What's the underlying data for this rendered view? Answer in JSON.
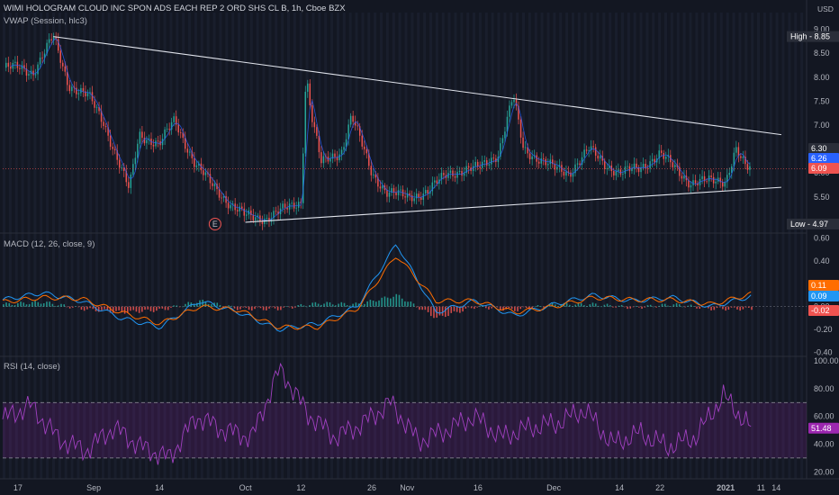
{
  "header": {
    "title": "WIMI HOLOGRAM CLOUD INC SPON ADS EACH REP 2 ORD SHS CL B, 1h, Cboe BZX",
    "currency": "USD"
  },
  "panes": {
    "price": {
      "label": "VWAP (Session, hlc3)"
    },
    "macd": {
      "label": "MACD (12, 26, close, 9)"
    },
    "rsi": {
      "label": "RSI (14, close)"
    }
  },
  "colors": {
    "background": "#131722",
    "up": "#26a69a",
    "down": "#ef5350",
    "vwap": "#2962ff",
    "macd": "#2196f3",
    "signal": "#ff6d00",
    "rsi": "#9c27b0",
    "trendline": "#e0e3eb"
  },
  "chart_data": [
    {
      "type": "candlestick",
      "pane": "price",
      "title": "WIMI HOLOGRAM CLOUD INC SPON ADS EACH REP 2 ORD SHS CL B, 1h, Cboe BZX",
      "x_ticks": [
        "17",
        "Sep",
        "14",
        "Oct",
        "12",
        "26",
        "Nov",
        "16",
        "Dec",
        "14",
        "22",
        "2021",
        "11",
        "14"
      ],
      "x_tick_dates": [
        "2020-08-17",
        "2020-09-01",
        "2020-09-14",
        "2020-10-01",
        "2020-10-12",
        "2020-10-26",
        "2020-11-02",
        "2020-11-16",
        "2020-12-01",
        "2020-12-14",
        "2020-12-22",
        "2021-01-04",
        "2021-01-11",
        "2021-01-14"
      ],
      "y_ticks": [
        9.0,
        8.5,
        8.0,
        7.5,
        7.0,
        6.5,
        6.0,
        5.5
      ],
      "ylim": [
        4.8,
        9.2
      ],
      "close_path": [
        {
          "date": "2020-08-17",
          "close": 8.2
        },
        {
          "date": "2020-08-20",
          "close": 8.1
        },
        {
          "date": "2020-08-24",
          "close": 8.85
        },
        {
          "date": "2020-08-27",
          "close": 7.85
        },
        {
          "date": "2020-08-31",
          "close": 7.6
        },
        {
          "date": "2020-09-03",
          "close": 7.05
        },
        {
          "date": "2020-09-08",
          "close": 5.65
        },
        {
          "date": "2020-09-10",
          "close": 6.8
        },
        {
          "date": "2020-09-14",
          "close": 6.6
        },
        {
          "date": "2020-09-17",
          "close": 7.1
        },
        {
          "date": "2020-09-21",
          "close": 6.2
        },
        {
          "date": "2020-09-24",
          "close": 5.8
        },
        {
          "date": "2020-09-28",
          "close": 5.35
        },
        {
          "date": "2020-10-01",
          "close": 5.1
        },
        {
          "date": "2020-10-05",
          "close": 5.05
        },
        {
          "date": "2020-10-08",
          "close": 5.2
        },
        {
          "date": "2020-10-12",
          "close": 5.4
        },
        {
          "date": "2020-10-13",
          "close": 8.1
        },
        {
          "date": "2020-10-14",
          "close": 7.25
        },
        {
          "date": "2020-10-16",
          "close": 6.2
        },
        {
          "date": "2020-10-20",
          "close": 6.45
        },
        {
          "date": "2020-10-22",
          "close": 7.2
        },
        {
          "date": "2020-10-26",
          "close": 6.0
        },
        {
          "date": "2020-10-29",
          "close": 5.6
        },
        {
          "date": "2020-11-02",
          "close": 5.5
        },
        {
          "date": "2020-11-06",
          "close": 5.6
        },
        {
          "date": "2020-11-10",
          "close": 6.0
        },
        {
          "date": "2020-11-16",
          "close": 6.1
        },
        {
          "date": "2020-11-20",
          "close": 6.4
        },
        {
          "date": "2020-11-23",
          "close": 7.6
        },
        {
          "date": "2020-11-25",
          "close": 6.5
        },
        {
          "date": "2020-12-01",
          "close": 6.1
        },
        {
          "date": "2020-12-04",
          "close": 6.0
        },
        {
          "date": "2020-12-08",
          "close": 6.5
        },
        {
          "date": "2020-12-11",
          "close": 6.2
        },
        {
          "date": "2020-12-14",
          "close": 6.0
        },
        {
          "date": "2020-12-18",
          "close": 6.1
        },
        {
          "date": "2020-12-22",
          "close": 6.4
        },
        {
          "date": "2020-12-28",
          "close": 5.8
        },
        {
          "date": "2021-01-04",
          "close": 5.85
        },
        {
          "date": "2021-01-06",
          "close": 6.5
        },
        {
          "date": "2021-01-08",
          "close": 6.09
        }
      ],
      "price_labels": {
        "high": "High - 8.85",
        "low": "Low - 4.97",
        "tags": [
          "6.30",
          "6.26",
          "6.09"
        ]
      },
      "trendlines": [
        {
          "from": {
            "date": "2020-08-24",
            "price": 8.85
          },
          "to": {
            "date": "2021-01-15",
            "price": 6.8
          }
        },
        {
          "from": {
            "date": "2020-10-01",
            "price": 4.97
          },
          "to": {
            "date": "2021-01-15",
            "price": 5.7
          }
        }
      ],
      "event_marker": {
        "date": "2020-09-25",
        "label": "E"
      }
    },
    {
      "type": "line",
      "pane": "macd",
      "title": "MACD (12, 26, close, 9)",
      "y_ticks": [
        0.6,
        0.4,
        0.0,
        -0.2,
        -0.4
      ],
      "ylim": [
        -0.42,
        0.62
      ],
      "series": [
        {
          "name": "MACD",
          "values": [
            0.06,
            0.12,
            0.05,
            -0.1,
            -0.18,
            0.05,
            -0.05,
            -0.2,
            -0.15,
            0.0,
            0.55,
            -0.05,
            0.05,
            -0.08,
            0.02,
            0.1,
            0.05,
            0.08,
            0.0,
            0.09
          ]
        },
        {
          "name": "Signal",
          "values": [
            0.04,
            0.08,
            0.07,
            -0.05,
            -0.15,
            0.0,
            -0.03,
            -0.18,
            -0.18,
            -0.02,
            0.45,
            0.05,
            0.05,
            -0.05,
            0.0,
            0.08,
            0.06,
            0.06,
            0.02,
            0.11
          ]
        }
      ],
      "histogram_values": [
        0.02,
        0.04,
        -0.02,
        -0.05,
        -0.03,
        0.05,
        -0.02,
        -0.02,
        0.03,
        0.02,
        0.1,
        -0.1,
        0.0,
        -0.03,
        0.02,
        0.02,
        -0.01,
        0.02,
        -0.02,
        -0.02
      ],
      "value_tags": [
        "0.11",
        "0.09",
        "-0.02"
      ]
    },
    {
      "type": "line",
      "pane": "rsi",
      "title": "RSI (14, close)",
      "y_ticks": [
        100.0,
        80.0,
        60.0,
        40.0,
        20.0
      ],
      "ylim": [
        15,
        102
      ],
      "bands": [
        70,
        30
      ],
      "series": [
        {
          "name": "RSI",
          "values": [
            58,
            68,
            44,
            35,
            52,
            38,
            30,
            60,
            50,
            45,
            95,
            62,
            45,
            55,
            70,
            42,
            50,
            60,
            45,
            52,
            55,
            65,
            40,
            48,
            38,
            45,
            75,
            51.48
          ]
        }
      ],
      "value_tag": "51.48"
    }
  ]
}
